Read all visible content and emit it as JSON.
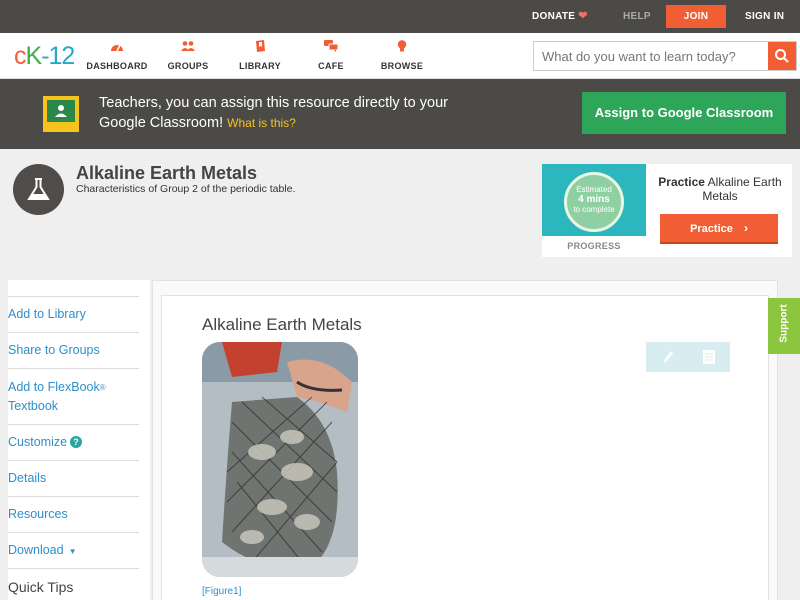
{
  "topbar": {
    "donate": "DONATE",
    "help": "HELP",
    "join": "JOIN",
    "signin": "SIGN IN"
  },
  "logo": {
    "part1": "c",
    "part2": "K",
    "part3": "-12"
  },
  "nav": {
    "dashboard": "DASHBOARD",
    "groups": "GROUPS",
    "library": "LIBRARY",
    "cafe": "CAFE",
    "browse": "BROWSE"
  },
  "search": {
    "placeholder": "What do you want to learn today?"
  },
  "banner": {
    "text": "Teachers, you can assign this resource directly to your Google Classroom!",
    "what": "What is this?",
    "assign": "Assign to Google Classroom"
  },
  "concept": {
    "title": "Alkaline Earth Metals",
    "subtitle": "Characteristics of Group 2 of the periodic table."
  },
  "practice": {
    "estimated": "Estimated",
    "mins": "4 mins",
    "to_complete": "to complete",
    "progress": "PROGRESS",
    "title_bold": "Practice",
    "title_rest": " Alkaline Earth Metals",
    "button": "Practice"
  },
  "sidebar": {
    "add_library": "Add to Library",
    "share_groups": "Share to Groups",
    "add_flexbook": "Add to FlexBook",
    "reg": "®",
    "textbook": "Textbook",
    "customize": "Customize",
    "customize_help": "?",
    "details": "Details",
    "resources": "Resources",
    "download": "Download",
    "quick_tips": "Quick Tips"
  },
  "main": {
    "title": "Alkaline Earth Metals",
    "figure_caption": "[Figure1]"
  },
  "support": "Support",
  "colors": {
    "brand_orange": "#f15e33",
    "assign_green": "#2da65a",
    "link_blue": "#2e8fc9",
    "support_green": "#8cc63f"
  }
}
